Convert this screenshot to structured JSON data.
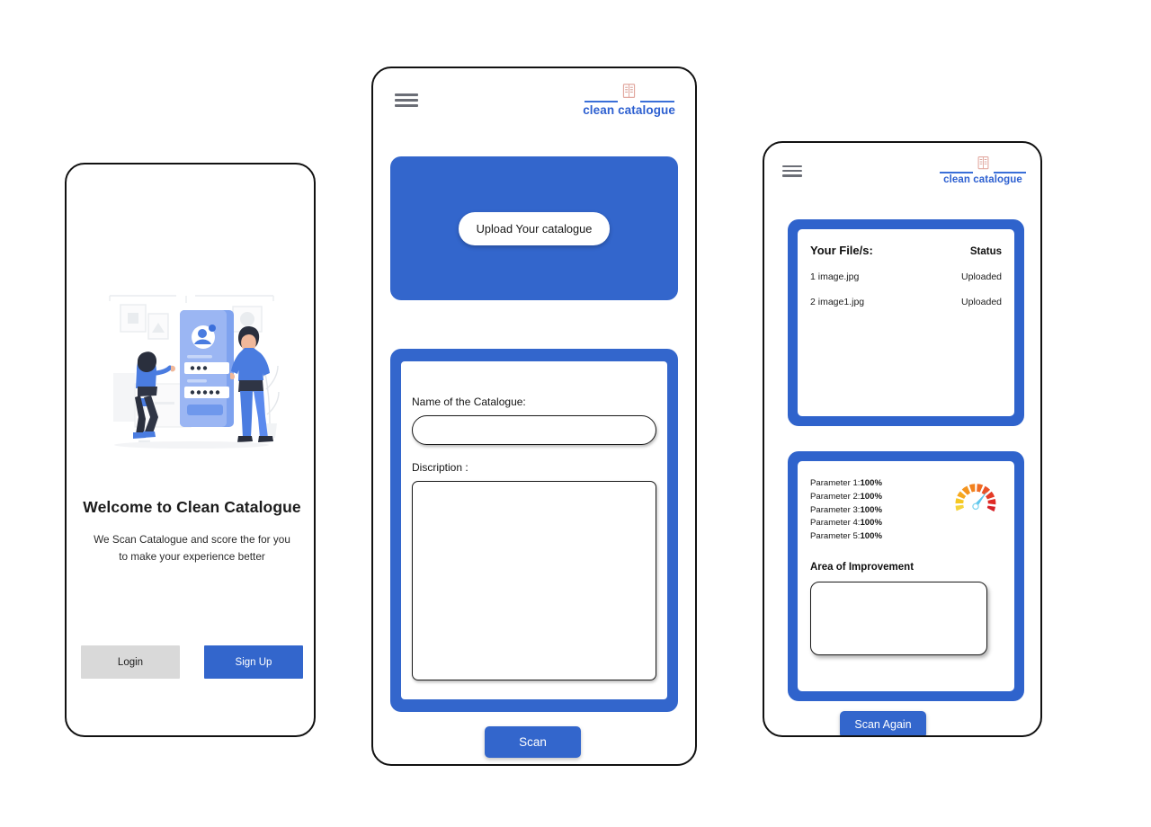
{
  "brand": {
    "logo_text": "clean catalogue",
    "accent_blue": "#3366cc",
    "panel_blue": "#2f63cc",
    "logo_blue": "#2c5fd0",
    "gray_button": "#d9d9d9"
  },
  "screen_welcome": {
    "title": "Welcome to Clean Catalogue",
    "subtitle": "We Scan Catalogue and score the for you to make your experience better",
    "login_label": "Login",
    "signup_label": "Sign Up",
    "illustration_name": "login-illustration"
  },
  "screen_upload": {
    "menu_icon": "hamburger-menu-icon",
    "logo_icon": "catalogue-book-icon",
    "upload_button_label": "Upload Your catalogue",
    "name_label": "Name of the Catalogue:",
    "name_value": "",
    "name_placeholder": "",
    "description_label": "Discription :",
    "description_value": "",
    "description_placeholder": "",
    "scan_button_label": "Scan"
  },
  "screen_result": {
    "menu_icon": "hamburger-menu-icon",
    "logo_icon": "catalogue-book-icon",
    "files_header_left": "Your File/s:",
    "files_header_right": "Status",
    "files": [
      {
        "index": "1",
        "name": "image.jpg",
        "status": "Uploaded"
      },
      {
        "index": "2",
        "name": "image1.jpg",
        "status": "Uploaded"
      }
    ],
    "parameters": [
      {
        "label": "Parameter 1:",
        "value": "100%"
      },
      {
        "label": "Parameter 2:",
        "value": "100%"
      },
      {
        "label": "Parameter 3:",
        "value": "100%"
      },
      {
        "label": "Parameter 4:",
        "value": "100%"
      },
      {
        "label": "Parameter 5:",
        "value": "100%"
      }
    ],
    "gauge_icon": "speedometer-gauge-icon",
    "improvement_label": "Area of Improvement",
    "improvement_value": "",
    "improvement_placeholder": "",
    "scan_again_label": "Scan Again"
  }
}
